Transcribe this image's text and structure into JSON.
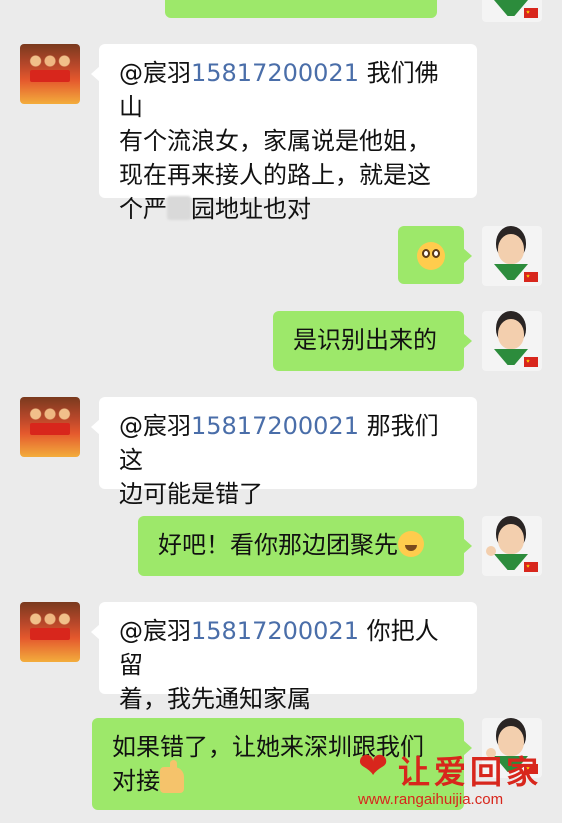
{
  "messages": [
    {
      "side": "right",
      "text": ""
    },
    {
      "side": "left",
      "mention": "@宸羽",
      "phone": "15817200021",
      "text_a": "我们佛山",
      "lines": [
        "有个流浪女，家属说是他姐，",
        "现在再来接人的路上，就是这"
      ],
      "line_last_a": "个严",
      "line_last_b": "园地址也对"
    },
    {
      "side": "right",
      "emoji": "flushed-face"
    },
    {
      "side": "right",
      "text": "是识别出来的"
    },
    {
      "side": "left",
      "mention": "@宸羽",
      "phone": "15817200021",
      "text_a": "那我们这",
      "lines": [
        "边可能是错了"
      ]
    },
    {
      "side": "right",
      "text": "好吧！看你那边团聚先",
      "emoji": "crying-laughing-face"
    },
    {
      "side": "left",
      "mention": "@宸羽",
      "phone": "15817200021",
      "text_a": "你把人留",
      "lines": [
        "着，我先通知家属"
      ]
    },
    {
      "side": "right",
      "lines": [
        "如果错了，让她来深圳跟我们",
        "对接"
      ],
      "emoji": "thumbs-up"
    }
  ],
  "watermark": {
    "title": "让爱回家",
    "url": "www.rangaihuijia.com",
    "heart_icon": "heart-icon"
  },
  "colors": {
    "background": "#ebebeb",
    "bubble_self": "#9de86a",
    "bubble_other": "#ffffff",
    "mention_link": "#4a6ea9",
    "watermark": "#d8261c"
  }
}
